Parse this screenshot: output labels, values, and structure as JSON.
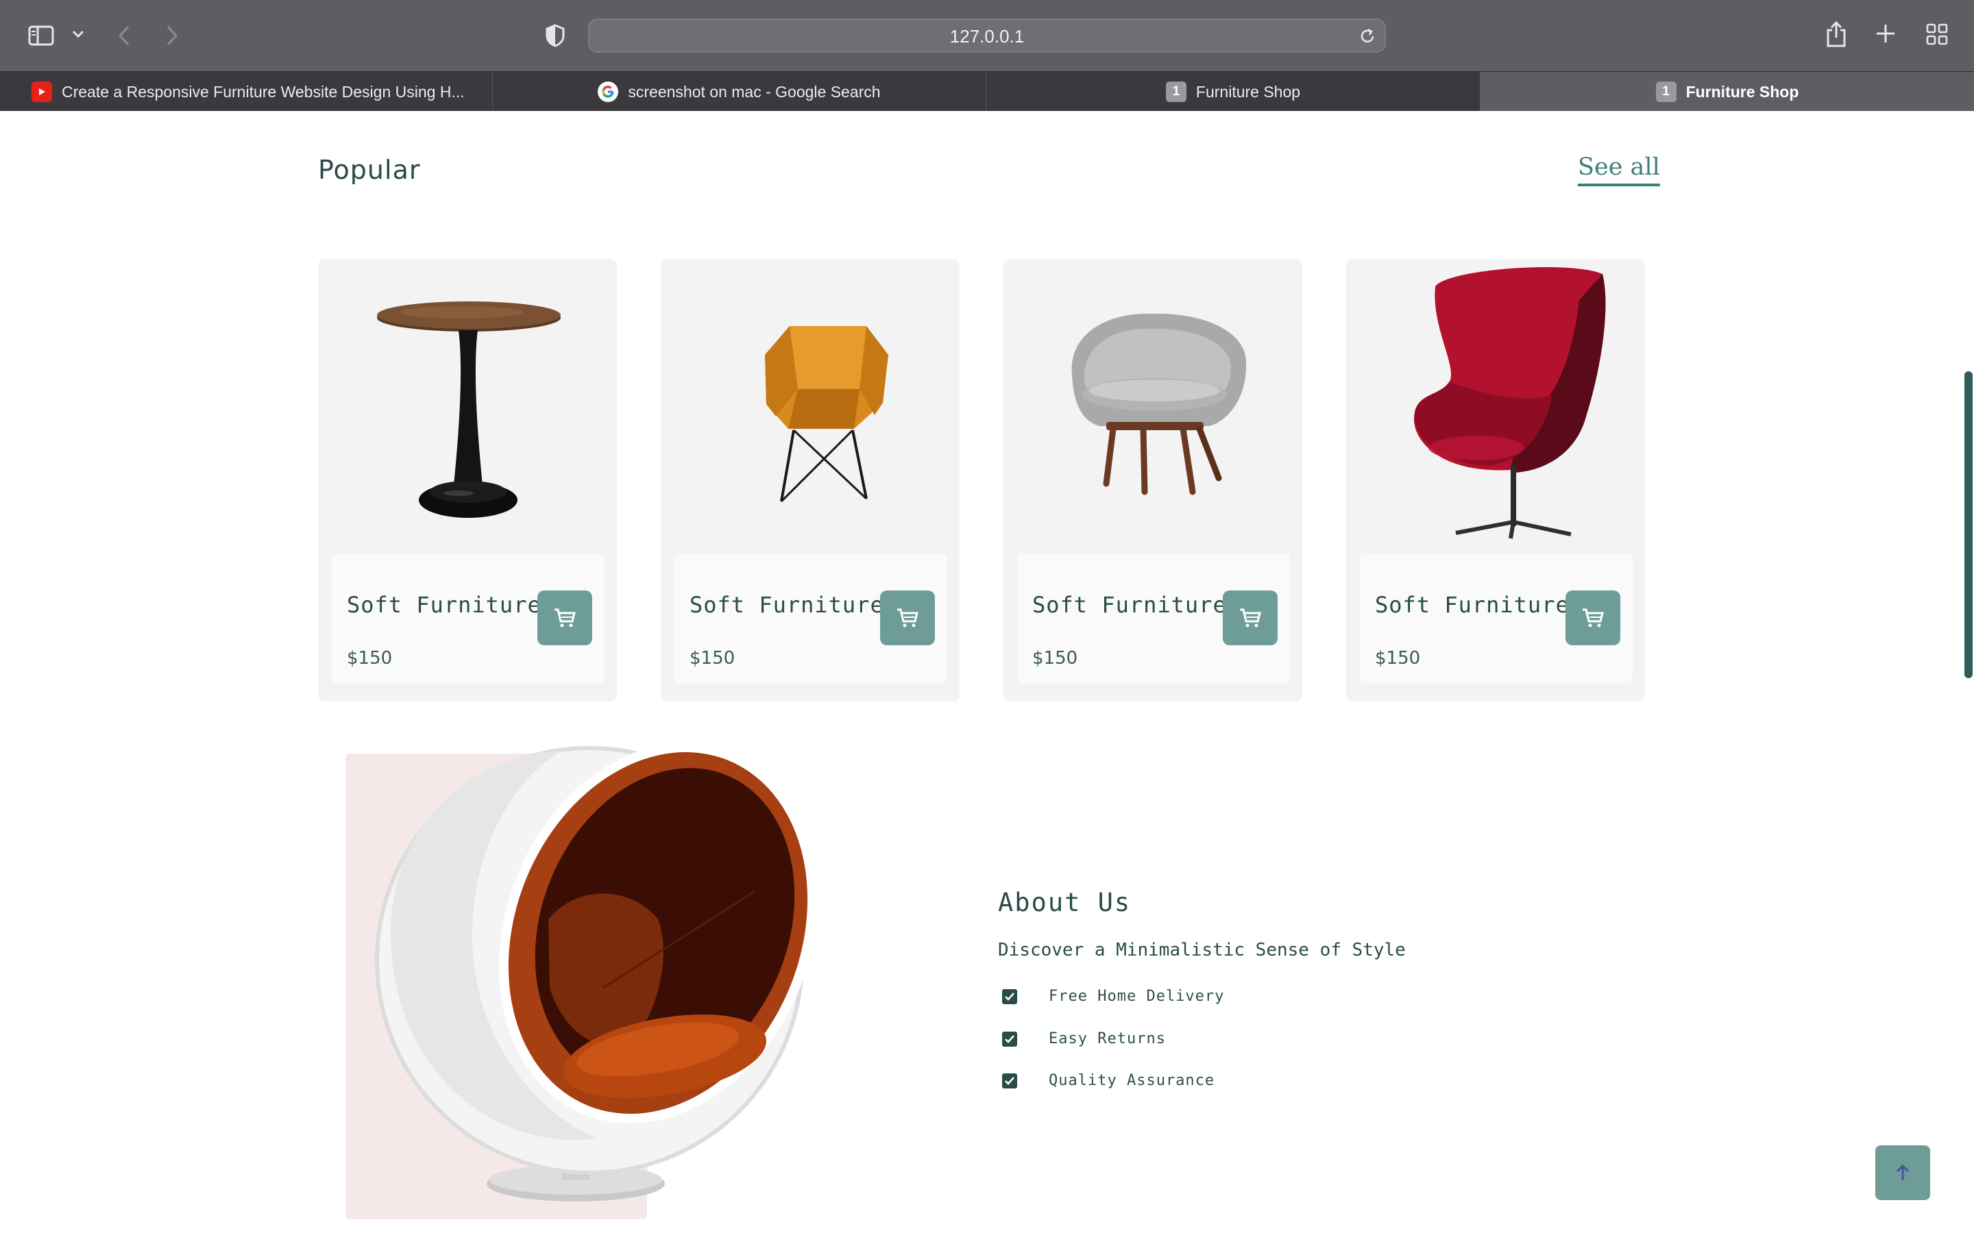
{
  "browser": {
    "url": "127.0.0.1",
    "tabs": [
      {
        "title": "Create a Responsive Furniture Website Design Using H...",
        "favicon": "youtube-icon"
      },
      {
        "title": "screenshot on mac - Google Search",
        "favicon": "google-icon"
      },
      {
        "title": "Furniture Shop",
        "favicon": "1",
        "badge": "1"
      },
      {
        "title": "Furniture Shop",
        "favicon": "1",
        "badge": "1",
        "active": true
      }
    ]
  },
  "popular": {
    "title": "Popular",
    "see_all": "See all",
    "products": [
      {
        "name": "Soft Furniture",
        "price": "$150",
        "image": "round-side-table"
      },
      {
        "name": "Soft Furniture",
        "price": "$150",
        "image": "orange-armchair"
      },
      {
        "name": "Soft Furniture",
        "price": "$150",
        "image": "grey-lounge-chair"
      },
      {
        "name": "Soft Furniture",
        "price": "$150",
        "image": "red-egg-chair"
      }
    ]
  },
  "about": {
    "title": "About Us",
    "subtitle": "Discover a Minimalistic Sense of Style",
    "features": [
      "Free Home Delivery",
      "Easy Returns",
      "Quality Assurance"
    ]
  },
  "colors": {
    "accent": "#6e9d98",
    "heading": "#2a4b48",
    "card_bg": "#f3f3f3",
    "about_bg": "#f4e9e8"
  }
}
